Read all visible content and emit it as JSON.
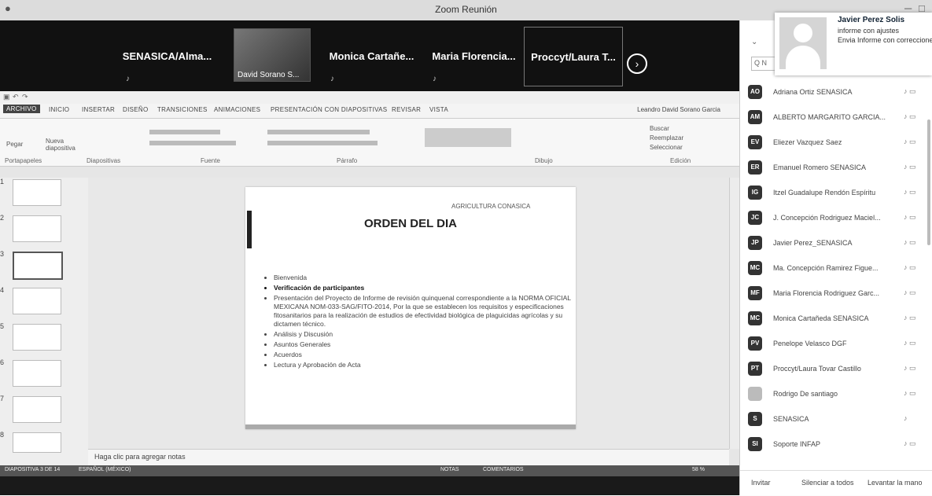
{
  "window": {
    "title": "Zoom Reunión"
  },
  "gallery": {
    "tiles": [
      {
        "name": "SENASICA/Alma..."
      },
      {
        "name": "David Sorano S..."
      },
      {
        "name": "Monica Cartañe..."
      },
      {
        "name": "Maria Florencia..."
      },
      {
        "name": "Proccyt/Laura T..."
      }
    ],
    "next_icon": "chevron-right-icon"
  },
  "ppt": {
    "tabs": [
      "ARCHIVO",
      "INICIO",
      "INSERTAR",
      "DISEÑO",
      "TRANSICIONES",
      "ANIMACIONES",
      "PRESENTACIÓN CON DIAPOSITIVAS",
      "REVISAR",
      "VISTA"
    ],
    "user": "Leandro David Sorano Garcia",
    "ribbon_groups": [
      "Portapapeles",
      "Diapositivas",
      "Fuente",
      "Párrafo",
      "Dibujo",
      "Edición"
    ],
    "ribbon_buttons": {
      "paste": "Pegar",
      "new_slide": "Nueva diapositiva",
      "find": "Buscar",
      "replace": "Reemplazar",
      "select": "Seleccionar"
    },
    "thumbs": [
      "1",
      "2",
      "3",
      "4",
      "5",
      "6",
      "7",
      "8"
    ],
    "slide": {
      "logos": "AGRICULTURA  CONASICA",
      "title": "ORDEN DEL DIA",
      "bullets": [
        "Bienvenida",
        "Verificación de participantes",
        "Presentación del Proyecto de Informe de revisión quinquenal correspondiente a la NORMA OFICIAL MEXICANA NOM-033-SAG/FITO-2014, Por la que se establecen los requisitos y especificaciones fitosanitarios para la realización de estudios de efectividad biológica de plaguicidas agrícolas y su dictamen técnico.",
        "Análisis y Discusión",
        "Asuntos Generales",
        "Acuerdos",
        "Lectura y Aprobación de Acta"
      ]
    },
    "notes_placeholder": "Haga clic para agregar notas",
    "status": {
      "slide": "DIAPOSITIVA 3 DE 14",
      "lang": "ESPAÑOL (MÉXICO)",
      "notes": "NOTAS",
      "comments": "COMENTARIOS",
      "zoom": "58 %"
    }
  },
  "notification": {
    "name": "Javier Perez Solis",
    "line1": "informe con ajustes",
    "line2": "Envia Informe con correcciones"
  },
  "participants": {
    "search_placeholder": "Q N",
    "list": [
      {
        "initials": "AO",
        "name": "Adriana Ortiz SENASICA"
      },
      {
        "initials": "AM",
        "name": "ALBERTO MARGARITO GARCIA..."
      },
      {
        "initials": "EV",
        "name": "Eliezer Vazquez Saez"
      },
      {
        "initials": "ER",
        "name": "Emanuel Romero SENASICA"
      },
      {
        "initials": "IG",
        "name": "Itzel Guadalupe Rendón Espíritu"
      },
      {
        "initials": "JC",
        "name": "J. Concepción Rodriguez Maciel..."
      },
      {
        "initials": "JP",
        "name": "Javier Perez_SENASICA"
      },
      {
        "initials": "MC",
        "name": "Ma. Concepción Ramirez Figue..."
      },
      {
        "initials": "MF",
        "name": "Maria Florencia Rodriguez Garc..."
      },
      {
        "initials": "MC",
        "name": "Monica Cartañeda SENASICA"
      },
      {
        "initials": "PV",
        "name": "Penelope Velasco DGF"
      },
      {
        "initials": "PT",
        "name": "Proccyt/Laura Tovar Castillo"
      },
      {
        "initials": "",
        "name": "Rodrigo De santiago"
      },
      {
        "initials": "S",
        "name": "SENASICA"
      },
      {
        "initials": "SI",
        "name": "Soporte INFAP"
      }
    ],
    "footer": {
      "invite": "Invitar",
      "mute_all": "Silenciar a todos",
      "raise_hand": "Levantar la mano"
    }
  }
}
